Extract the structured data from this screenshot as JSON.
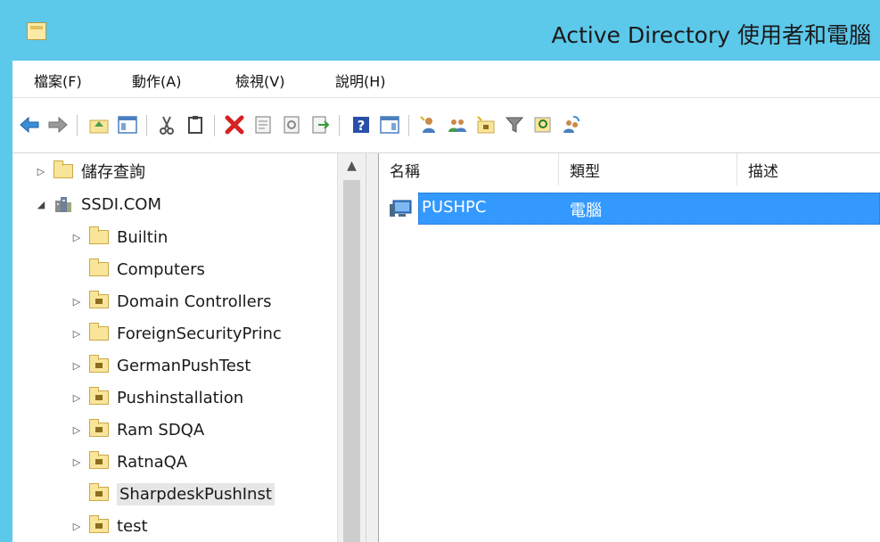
{
  "window": {
    "title": "Active Directory 使用者和電腦"
  },
  "menu": {
    "items": [
      "檔案(F)",
      "動作(A)",
      "檢視(V)",
      "說明(H)"
    ]
  },
  "toolbar": {
    "icons": [
      "back-arrow-icon",
      "forward-arrow-icon",
      "up-folder-icon",
      "show-console-tree-icon",
      "cut-icon",
      "copy-icon",
      "delete-icon",
      "properties-icon",
      "refresh-icon",
      "export-list-icon",
      "help-icon",
      "action-pane-icon",
      "new-user-icon",
      "new-group-icon",
      "new-ou-icon",
      "filter-icon",
      "find-icon",
      "add-to-group-icon"
    ]
  },
  "tree": {
    "items": [
      {
        "label": "儲存查詢",
        "expander": "▷",
        "icon": "folder-icon",
        "level": 0
      },
      {
        "label": "SSDI.COM",
        "expander": "◢",
        "icon": "domain-icon",
        "level": 0
      },
      {
        "label": "Builtin",
        "expander": "▷",
        "icon": "folder-icon",
        "level": 1
      },
      {
        "label": "Computers",
        "expander": "",
        "icon": "folder-icon",
        "level": 1
      },
      {
        "label": "Domain Controllers",
        "expander": "▷",
        "icon": "ou-folder-icon",
        "level": 1
      },
      {
        "label": "ForeignSecurityPrinc",
        "expander": "▷",
        "icon": "folder-icon",
        "level": 1
      },
      {
        "label": "GermanPushTest",
        "expander": "▷",
        "icon": "ou-folder-icon",
        "level": 1
      },
      {
        "label": "Pushinstallation",
        "expander": "▷",
        "icon": "ou-folder-icon",
        "level": 1
      },
      {
        "label": "Ram SDQA",
        "expander": "▷",
        "icon": "ou-folder-icon",
        "level": 1
      },
      {
        "label": "RatnaQA",
        "expander": "▷",
        "icon": "ou-folder-icon",
        "level": 1
      },
      {
        "label": "SharpdeskPushInst",
        "expander": "",
        "icon": "ou-folder-icon",
        "level": 1,
        "selected": true
      },
      {
        "label": "test",
        "expander": "▷",
        "icon": "ou-folder-icon",
        "level": 1
      }
    ]
  },
  "list": {
    "columns": [
      "名稱",
      "類型",
      "描述"
    ],
    "rows": [
      {
        "name": "PUSHPC",
        "type": "電腦",
        "description": "",
        "icon": "computer-icon",
        "selected": true
      }
    ]
  },
  "colors": {
    "titlebar": "#5cc8ea",
    "selection": "#3399ff"
  }
}
